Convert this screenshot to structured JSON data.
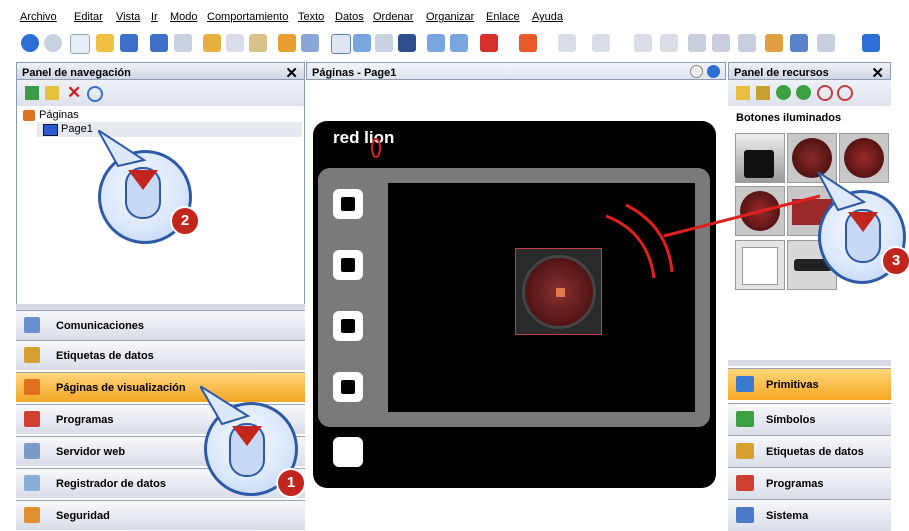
{
  "menu": [
    "Archivo",
    "Editar",
    "Vista",
    "Ir",
    "Modo",
    "Comportamiento",
    "Texto",
    "Datos",
    "Ordenar",
    "Organizar",
    "Enlace",
    "Ayuda"
  ],
  "nav_panel": {
    "title": "Panel de navegación",
    "tree_root": "Páginas",
    "tree_child": "Page1"
  },
  "sections_left": [
    "Comunicaciones",
    "Etiquetas de datos",
    "Páginas de visualización",
    "Programas",
    "Servidor web",
    "Registrador de datos",
    "Seguridad"
  ],
  "selected_left": "Páginas de visualización",
  "editor": {
    "title": "Páginas - Page1",
    "device_logo": "red lion"
  },
  "resource_panel": {
    "title": "Panel de recursos",
    "category": "Botones iluminados"
  },
  "sections_right": [
    "Primitivas",
    "Símbolos",
    "Etiquetas de datos",
    "Programas",
    "Sistema"
  ],
  "selected_right": "Primitivas",
  "callouts": [
    "1",
    "2",
    "3"
  ],
  "colors": {
    "accent_orange": "#f5a623",
    "callout_red": "#c0261d",
    "panel_blue": "#2c5aa6",
    "annotation_red": "#e0201c"
  }
}
